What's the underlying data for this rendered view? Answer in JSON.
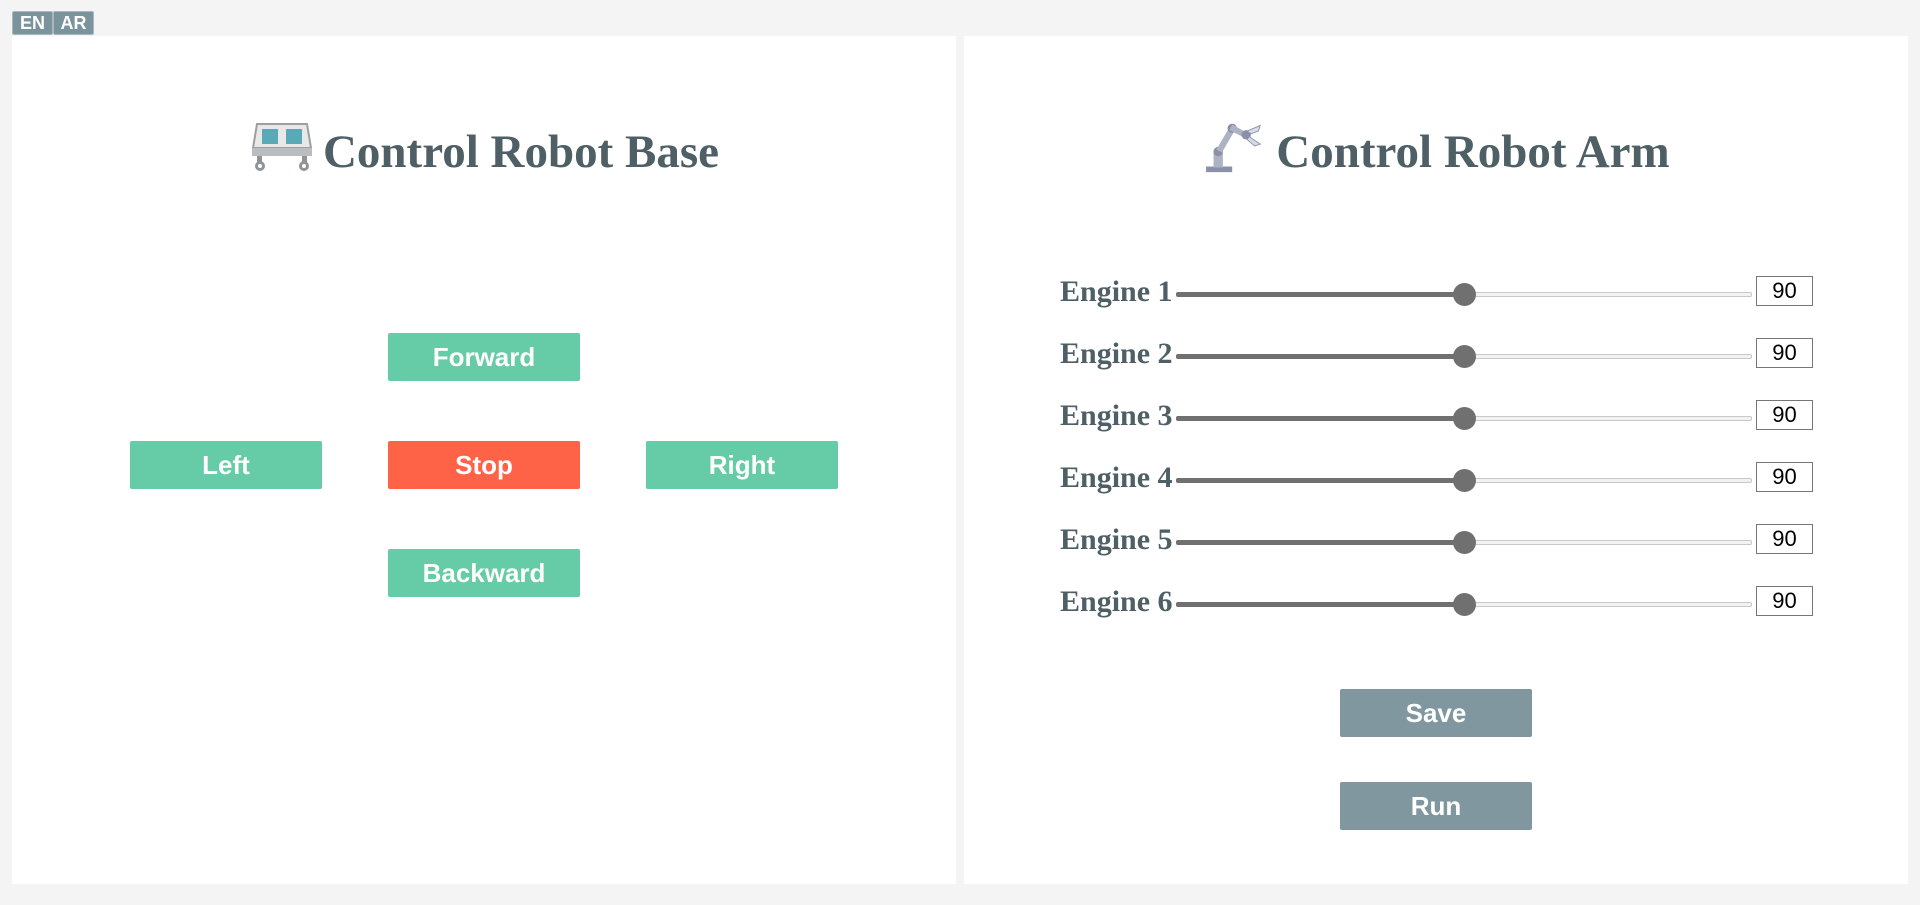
{
  "language": {
    "en": "EN",
    "ar": "AR"
  },
  "base_panel": {
    "title": "Control Robot Base",
    "icon": "robot-base-icon",
    "buttons": {
      "forward": "Forward",
      "left": "Left",
      "stop": "Stop",
      "right": "Right",
      "backward": "Backward"
    }
  },
  "arm_panel": {
    "title": "Control Robot Arm",
    "icon": "robot-arm-icon",
    "engines": [
      {
        "label": "Engine 1",
        "value": "90",
        "level": 0.5
      },
      {
        "label": "Engine 2",
        "value": "90",
        "level": 0.5
      },
      {
        "label": "Engine 3",
        "value": "90",
        "level": 0.5
      },
      {
        "label": "Engine 4",
        "value": "90",
        "level": 0.5
      },
      {
        "label": "Engine 5",
        "value": "90",
        "level": 0.5
      },
      {
        "label": "Engine 6",
        "value": "90",
        "level": 0.5
      }
    ],
    "save_label": "Save",
    "run_label": "Run"
  },
  "colors": {
    "green": "#66cca8",
    "red": "#ff6347",
    "grey": "#80979f",
    "title": "#4e5f66"
  }
}
